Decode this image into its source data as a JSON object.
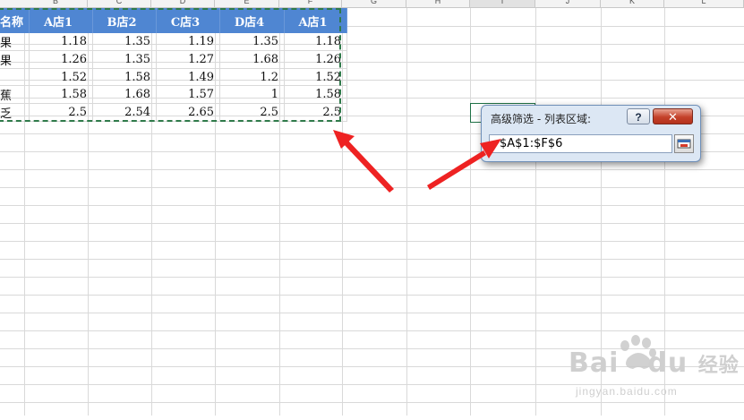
{
  "columns": [
    "B",
    "C",
    "D",
    "E",
    "F",
    "G",
    "H",
    "I",
    "J",
    "K",
    "L"
  ],
  "active_column": "I",
  "table": {
    "headers": [
      "名称",
      "A店1",
      "B店2",
      "C店3",
      "D店4",
      "A店1"
    ],
    "rows": [
      [
        "果",
        "1.18",
        "1.35",
        "1.19",
        "1.35",
        "1.18"
      ],
      [
        "果",
        "1.26",
        "1.35",
        "1.27",
        "1.68",
        "1.26"
      ],
      [
        "",
        "1.52",
        "1.58",
        "1.49",
        "1.2",
        "1.52"
      ],
      [
        "蕉",
        "1.58",
        "1.68",
        "1.57",
        "1",
        "1.58"
      ],
      [
        "乏",
        "2.5",
        "2.54",
        "2.65",
        "2.5",
        "2.5"
      ]
    ]
  },
  "dialog": {
    "title": "高级筛选 - 列表区域:",
    "help_label": "?",
    "close_label": "✕",
    "range_value": "$A$1:$F$6",
    "collapse_icon": "collapse-dialog-icon"
  },
  "annotations": {
    "arrow_color": "#ee2222"
  },
  "watermark": {
    "brand": "Bai",
    "brand_tail": "du",
    "cn": "经验",
    "url": "jingyan.baidu.com"
  }
}
